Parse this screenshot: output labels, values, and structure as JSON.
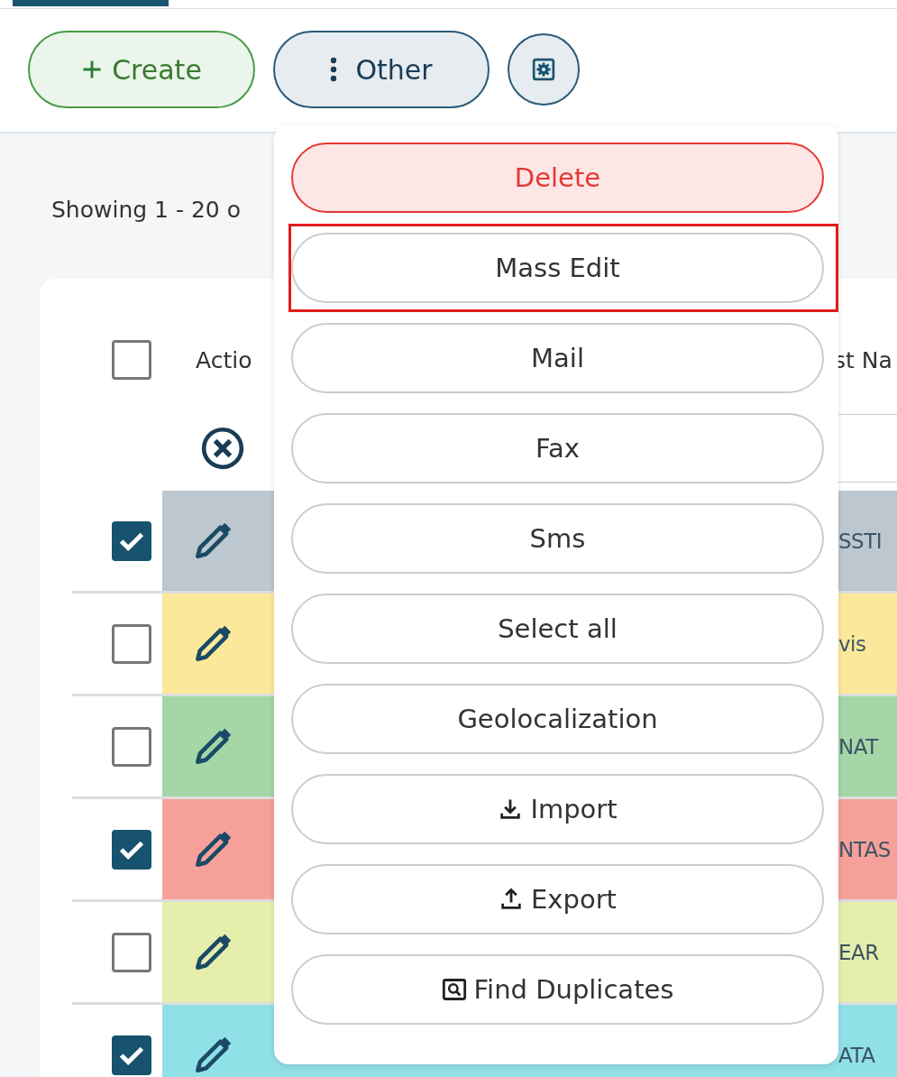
{
  "toolbar": {
    "create_button": "Create",
    "other_button": "Other"
  },
  "results_summary": "Showing 1 - 20 o",
  "table": {
    "header": {
      "checked": false,
      "action_label": "Actio",
      "last_column_label": "st Na"
    },
    "rows": [
      {
        "checked": true,
        "color": "#bcc7cf",
        "last_cell": "SSTI"
      },
      {
        "checked": false,
        "color": "#fbe89a",
        "last_cell": "vis"
      },
      {
        "checked": false,
        "color": "#a5d6a7",
        "last_cell": "NAT"
      },
      {
        "checked": true,
        "color": "#f6a09a",
        "last_cell": "NTAS"
      },
      {
        "checked": false,
        "color": "#e6eeac",
        "last_cell": "EAR"
      },
      {
        "checked": true,
        "color": "#90e0e8",
        "last_cell": "ATA"
      }
    ]
  },
  "menu": {
    "items": [
      {
        "label": "Delete",
        "kind": "danger",
        "highlighted": false
      },
      {
        "label": "Mass Edit",
        "kind": "plain",
        "highlighted": true
      },
      {
        "label": "Mail",
        "kind": "plain",
        "highlighted": false
      },
      {
        "label": "Fax",
        "kind": "plain",
        "highlighted": false
      },
      {
        "label": "Sms",
        "kind": "plain",
        "highlighted": false
      },
      {
        "label": "Select all",
        "kind": "plain",
        "highlighted": false
      },
      {
        "label": "Geolocalization",
        "kind": "plain",
        "highlighted": false
      },
      {
        "label": "Import",
        "kind": "import",
        "highlighted": false
      },
      {
        "label": "Export",
        "kind": "export",
        "highlighted": false
      },
      {
        "label": "Find Duplicates",
        "kind": "duplicates",
        "highlighted": false
      }
    ]
  }
}
